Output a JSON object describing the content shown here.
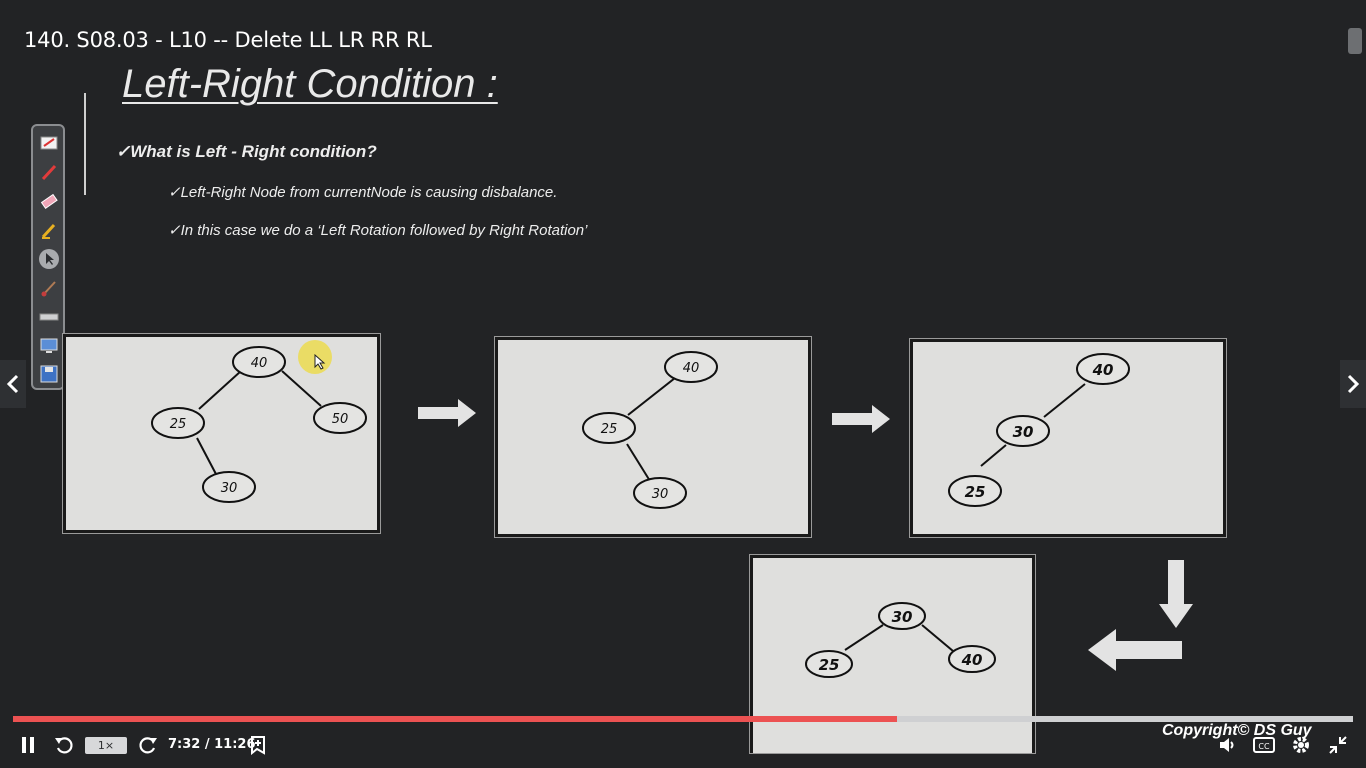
{
  "video": {
    "title": "140. S08.03 - L10 -- Delete LL LR RR RL"
  },
  "slide": {
    "heading": "Left-Right Condition :",
    "bullets": [
      "✓What is Left - Right condition?",
      "✓Left-Right Node from currentNode is causing disbalance.",
      "✓In this case we do a ‘Left Rotation followed by Right Rotation’"
    ],
    "copyright": "Copyright© DS Guy"
  },
  "trees": [
    {
      "nodes": [
        "40",
        "25",
        "50",
        "30"
      ]
    },
    {
      "nodes": [
        "40",
        "25",
        "30"
      ]
    },
    {
      "nodes": [
        "40",
        "30",
        "25"
      ]
    },
    {
      "nodes": [
        "30",
        "25",
        "40"
      ]
    }
  ],
  "toolbar": {
    "tools": [
      "notepad-icon",
      "pen-icon",
      "eraser-icon",
      "highlighter-icon",
      "pointer-icon",
      "brush-icon",
      "ruler-icon",
      "screen-icon",
      "save-icon"
    ]
  },
  "player": {
    "playback_rate": "1×",
    "time": "7:32 / 11:26",
    "progress": 0.66,
    "progress_color": "#ec5252",
    "icons": [
      "pause-icon",
      "rewind-icon",
      "forward-icon",
      "add-note-icon",
      "volume-icon",
      "captions-icon",
      "settings-icon",
      "fullscreen-exit-icon"
    ]
  }
}
